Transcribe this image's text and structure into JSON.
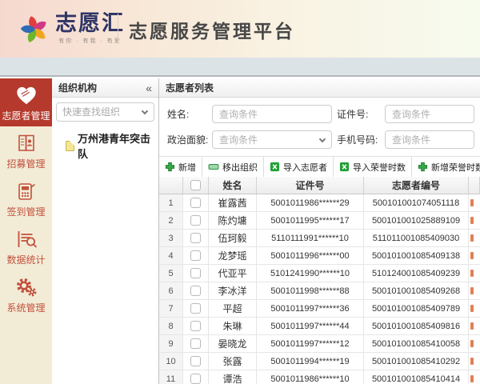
{
  "header": {
    "logo_text": "志愿汇",
    "logo_tagline": "有你 · 有我 · 有爱",
    "title": "志愿服务管理平台"
  },
  "sidebar": {
    "items": [
      {
        "key": "volunteer-management",
        "label": "志愿者管理",
        "icon": "heart-hand-icon",
        "active": true
      },
      {
        "key": "recruit-management",
        "label": "招募管理",
        "icon": "recruit-book-icon",
        "active": false
      },
      {
        "key": "checkin-management",
        "label": "签到管理",
        "icon": "checkin-terminal-icon",
        "active": false
      },
      {
        "key": "data-statistics",
        "label": "数据统计",
        "icon": "stats-search-icon",
        "active": false
      },
      {
        "key": "system-management",
        "label": "系统管理",
        "icon": "gear-icon",
        "active": false
      }
    ]
  },
  "org_panel": {
    "title": "组织机构",
    "collapse_glyph": "«",
    "search_placeholder": "快速查找组织",
    "tree_items": [
      {
        "label": "万州港青年突击队",
        "icon": "document-icon"
      }
    ]
  },
  "main": {
    "title": "志愿者列表",
    "filters": [
      {
        "key": "name",
        "label": "姓名:",
        "placeholder": "查询条件",
        "type": "text"
      },
      {
        "key": "id-number",
        "label": "证件号:",
        "placeholder": "查询条件",
        "type": "text"
      },
      {
        "key": "political-status",
        "label": "政治面貌:",
        "placeholder": "查询条件",
        "type": "select"
      },
      {
        "key": "mobile",
        "label": "手机号码:",
        "placeholder": "查询条件",
        "type": "text"
      }
    ],
    "toolbar": [
      {
        "key": "add",
        "label": "新增",
        "icon": "plus-icon"
      },
      {
        "key": "remove-from-org",
        "label": "移出组织",
        "icon": "minus-icon"
      },
      {
        "key": "import-volunteers",
        "label": "导入志愿者",
        "icon": "excel-import-icon"
      },
      {
        "key": "import-honor-hours",
        "label": "导入荣誉时数",
        "icon": "excel-import-icon"
      },
      {
        "key": "add-honor-hours",
        "label": "新增荣誉时数",
        "icon": "plus-icon"
      }
    ],
    "table": {
      "columns": [
        "姓名",
        "证件号",
        "志愿者编号"
      ],
      "rows": [
        {
          "index": "1",
          "name": "崔露茜",
          "id_number": "5001011986******29",
          "volunteer_no": "500101001074051118"
        },
        {
          "index": "2",
          "name": "陈灼墉",
          "id_number": "5001011995******17",
          "volunteer_no": "500101001025889109"
        },
        {
          "index": "3",
          "name": "伍珂毅",
          "id_number": "5110111991******10",
          "volunteer_no": "511011001085409030"
        },
        {
          "index": "4",
          "name": "龙梦瑶",
          "id_number": "5001011996******00",
          "volunteer_no": "500101001085409138"
        },
        {
          "index": "5",
          "name": "代亚平",
          "id_number": "5101241990******10",
          "volunteer_no": "510124001085409239"
        },
        {
          "index": "6",
          "name": "李冰洋",
          "id_number": "5001011998******88",
          "volunteer_no": "500101001085409268"
        },
        {
          "index": "7",
          "name": "平超",
          "id_number": "5001011997******36",
          "volunteer_no": "500101001085409789"
        },
        {
          "index": "8",
          "name": "朱琳",
          "id_number": "5001011997******44",
          "volunteer_no": "500101001085409816"
        },
        {
          "index": "9",
          "name": "晏晓龙",
          "id_number": "5001011997******12",
          "volunteer_no": "500101001085410058"
        },
        {
          "index": "10",
          "name": "张露",
          "id_number": "5001011994******19",
          "volunteer_no": "500101001085410292"
        },
        {
          "index": "11",
          "name": "谭浩",
          "id_number": "5001011986******10",
          "volunteer_no": "500101001085410414"
        }
      ]
    }
  },
  "colors": {
    "sidebar_active_bg": "#b5392c",
    "sidebar_item_red": "#c2503c",
    "sidebar_bg": "#f2ecd7",
    "accent_green": "#2f9d3f",
    "header_gradient_left": "#f6d8cf",
    "header_gradient_right": "#f7fbee",
    "strip_blue_gray": "#dce3e7",
    "logo_navy": "#2f3566"
  }
}
